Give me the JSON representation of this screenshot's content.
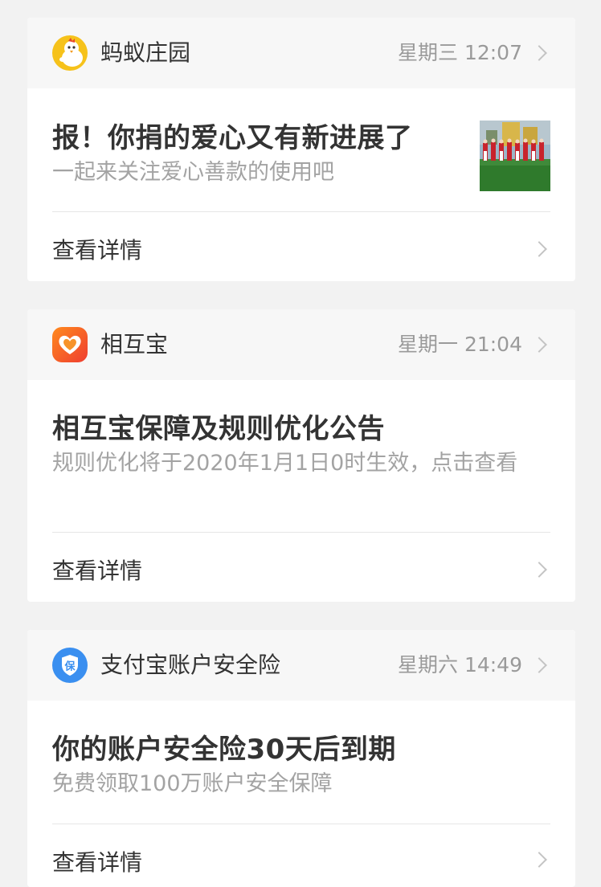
{
  "cards": [
    {
      "app_name": "蚂蚁庄园",
      "time": "星期三 12:07",
      "icon": "chick-icon",
      "title": "报！你捐的爱心又有新进展了",
      "subtitle": "一起来关注爱心善款的使用吧",
      "detail_label": "查看详情"
    },
    {
      "app_name": "相互宝",
      "time": "星期一 21:04",
      "icon": "heart-logo-icon",
      "title": "相互宝保障及规则优化公告",
      "subtitle": "规则优化将于2020年1月1日0时生效，点击查看",
      "detail_label": "查看详情"
    },
    {
      "app_name": "支付宝账户安全险",
      "time": "星期六 14:49",
      "icon": "shield-bao-icon",
      "icon_glyph": "保",
      "title": "你的账户安全险30天后到期",
      "subtitle": "免费领取100万账户安全保障",
      "detail_label": "查看详情"
    }
  ],
  "colors": {
    "background": "#f2f2f2",
    "card": "#ffffff",
    "card_header": "#f7f7f7",
    "title_text": "#333333",
    "secondary_text": "#a3a3a3",
    "chevron": "#c4c4c4",
    "antfarm_yellow": "#f6c21b",
    "xianghubao_orange": "#f4622a",
    "safety_blue": "#3a8ff0"
  }
}
